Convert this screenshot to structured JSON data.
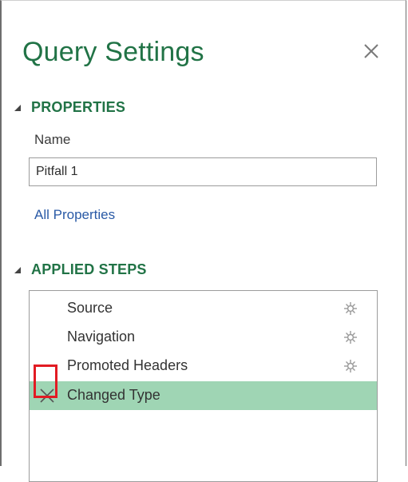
{
  "panel": {
    "title": "Query Settings"
  },
  "properties": {
    "header": "PROPERTIES",
    "name_label": "Name",
    "name_value": "Pitfall 1",
    "all_properties_link": "All Properties"
  },
  "applied_steps": {
    "header": "APPLIED STEPS",
    "steps": [
      {
        "label": "Source",
        "has_gear": true,
        "selected": false
      },
      {
        "label": "Navigation",
        "has_gear": true,
        "selected": false
      },
      {
        "label": "Promoted Headers",
        "has_gear": true,
        "selected": false
      },
      {
        "label": "Changed Type",
        "has_gear": false,
        "selected": true
      }
    ]
  },
  "icons": {
    "close": "close-icon",
    "collapse": "collapse-triangle-icon",
    "settings": "gear-icon",
    "delete": "delete-x-icon"
  },
  "colors": {
    "accent_green": "#217346",
    "selected_row": "#9fd5b4",
    "link_blue": "#2a5aa6",
    "highlight_red": "#e21b23"
  }
}
